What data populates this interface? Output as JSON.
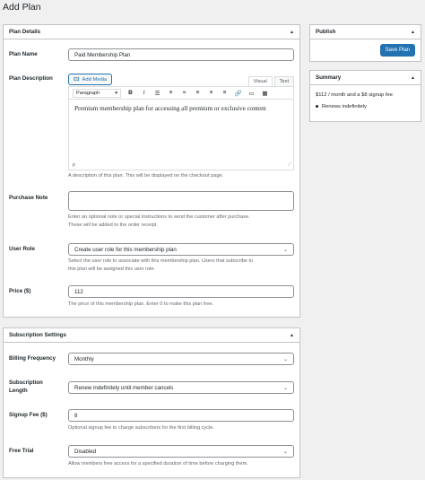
{
  "page": {
    "title": "Add Plan"
  },
  "plan_details": {
    "heading": "Plan Details",
    "plan_name": {
      "label": "Plan Name",
      "value": "Paid Membership Plan"
    },
    "plan_description": {
      "label": "Plan Description",
      "add_media": "Add Media",
      "tabs": {
        "visual": "Visual",
        "text": "Text"
      },
      "paragraph": "Paragraph",
      "content": "Premium membership plan for accessing all premium or exclusive content",
      "status_tag": "p",
      "help": "A description of this plan. This will be displayed on the checkout page."
    },
    "purchase_note": {
      "label": "Purchase Note",
      "value": "",
      "help_line1": "Enter an optional note or special instructions to send the customer after purchase.",
      "help_line2": "These will be added to the order receipt."
    },
    "user_role": {
      "label": "User Role",
      "value": "Create user role for this membership plan",
      "help_line1": "Select the user role to associate with this membership plan. Users that subscribe to",
      "help_line2": "this plan will be assigned this user role."
    },
    "price": {
      "label": "Price ($)",
      "value": "112",
      "help": "The price of this membership plan. Enter 0 to make this plan free."
    }
  },
  "subscription_settings": {
    "heading": "Subscription Settings",
    "billing_frequency": {
      "label": "Billing Frequency",
      "value": "Monthly"
    },
    "subscription_length": {
      "label_line1": "Subscription",
      "label_line2": "Length",
      "value": "Renew indefinitely until member cancels"
    },
    "signup_fee": {
      "label": "Signup Fee ($)",
      "value": "8",
      "help": "Optional signup fee to charge subscribers for the first billing cycle."
    },
    "free_trial": {
      "label": "Free Trial",
      "value": "Disabled",
      "help": "Allow members free access for a specified duration of time before charging them."
    }
  },
  "publish": {
    "heading": "Publish",
    "save_label": "Save Plan"
  },
  "summary": {
    "heading": "Summary",
    "price_line": "$112 / month and a $8 signup fee",
    "renew_line": "Renews indefinitely"
  },
  "icons": {
    "toggle": "caret-up-icon",
    "select": "chevron-down-icon"
  },
  "colors": {
    "accent": "#2271b1",
    "border": "#c3c4c7",
    "background": "#f0f0f1"
  }
}
